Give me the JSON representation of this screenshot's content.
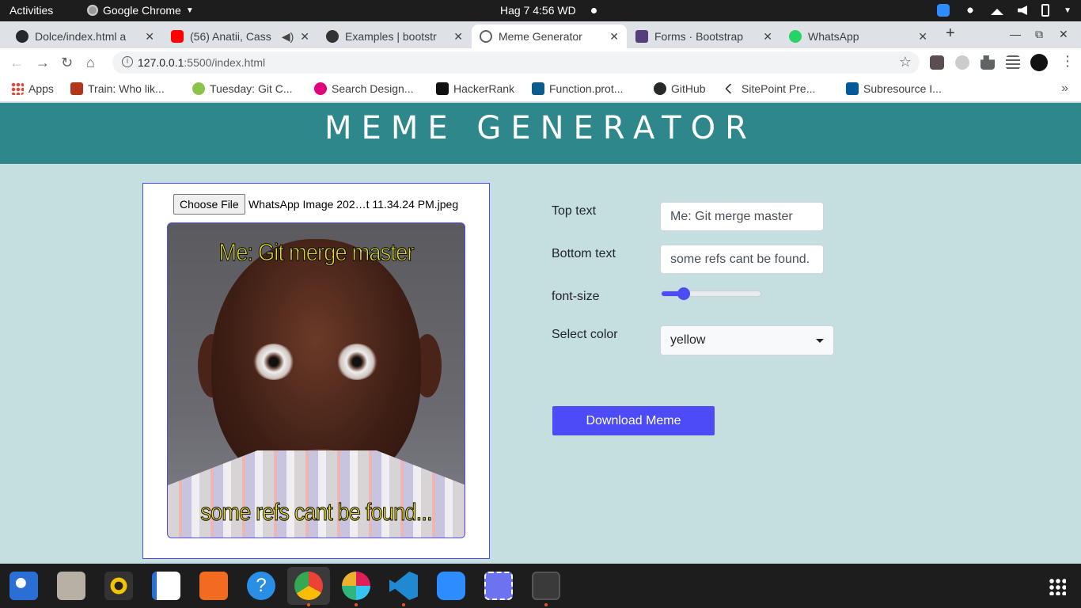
{
  "system": {
    "activities": "Activities",
    "app_name": "Google Chrome",
    "clock": "Hag 7   4:56 WD"
  },
  "tabs": [
    {
      "title": "Dolce/index.html a",
      "icon": "github-icon",
      "color": "#24292e"
    },
    {
      "title": "(56) Anatii, Cass",
      "icon": "youtube-icon",
      "color": "#ff0000"
    },
    {
      "title": "Examples | bootstr",
      "icon": "bootstrap-examples-icon",
      "color": "#333333"
    },
    {
      "title": "Meme Generator",
      "icon": "globe-icon",
      "color": "#5f6368",
      "active": true
    },
    {
      "title": "Forms · Bootstrap",
      "icon": "bootstrap-icon",
      "color": "#563d7c"
    },
    {
      "title": "WhatsApp",
      "icon": "whatsapp-icon",
      "color": "#25d366"
    }
  ],
  "address": {
    "host": "127.0.0.1",
    "path": ":5500/index.html"
  },
  "bookmarks": [
    {
      "label": "Apps",
      "icon": "apps-grid-icon",
      "color": "#4285f4"
    },
    {
      "label": "Train: Who lik...",
      "icon": "codewars-icon",
      "color": "#b1361e"
    },
    {
      "label": "Tuesday: Git C...",
      "icon": "moringa-icon",
      "color": "#8bc34a"
    },
    {
      "label": "Search Design...",
      "icon": "dribbble-icon",
      "color": "#e4007c"
    },
    {
      "label": "HackerRank",
      "icon": "hackerrank-icon",
      "color": "#1ba94c"
    },
    {
      "label": "Function.prot...",
      "icon": "mdn-icon",
      "color": "#0b5b8c"
    },
    {
      "label": "GitHub",
      "icon": "github-icon",
      "color": "#24292e"
    },
    {
      "label": "SitePoint Pre...",
      "icon": "sitepoint-icon",
      "color": "#333333"
    },
    {
      "label": "Subresource I...",
      "icon": "w3c-icon",
      "color": "#005a9c"
    }
  ],
  "page": {
    "title": "MEME GENERATOR",
    "choose_file": "Choose File",
    "file_name": "WhatsApp Image 202…t 11.34.24 PM.jpeg",
    "meme_top": "Me: Git merge master",
    "meme_bottom": "some refs cant be found...",
    "top_label": "Top text",
    "top_value": "Me: Git merge master",
    "bottom_label": "Bottom text",
    "bottom_value": "some refs cant be found.",
    "font_label": "font-size",
    "font_level": 0.22,
    "color_label": "Select color",
    "color_value": "yellow",
    "download": "Download Meme",
    "accent": "#4b4cf5",
    "header_bg": "#2e878a",
    "page_bg": "#c5dfe0"
  },
  "dock": [
    "thunderbird-icon",
    "files-icon",
    "rhythmbox-icon",
    "libreoffice-writer-icon",
    "software-center-icon",
    "help-icon",
    "chrome-icon",
    "slack-icon",
    "vscode-icon",
    "zoom-icon",
    "screenshot-icon",
    "system-monitor-icon"
  ]
}
